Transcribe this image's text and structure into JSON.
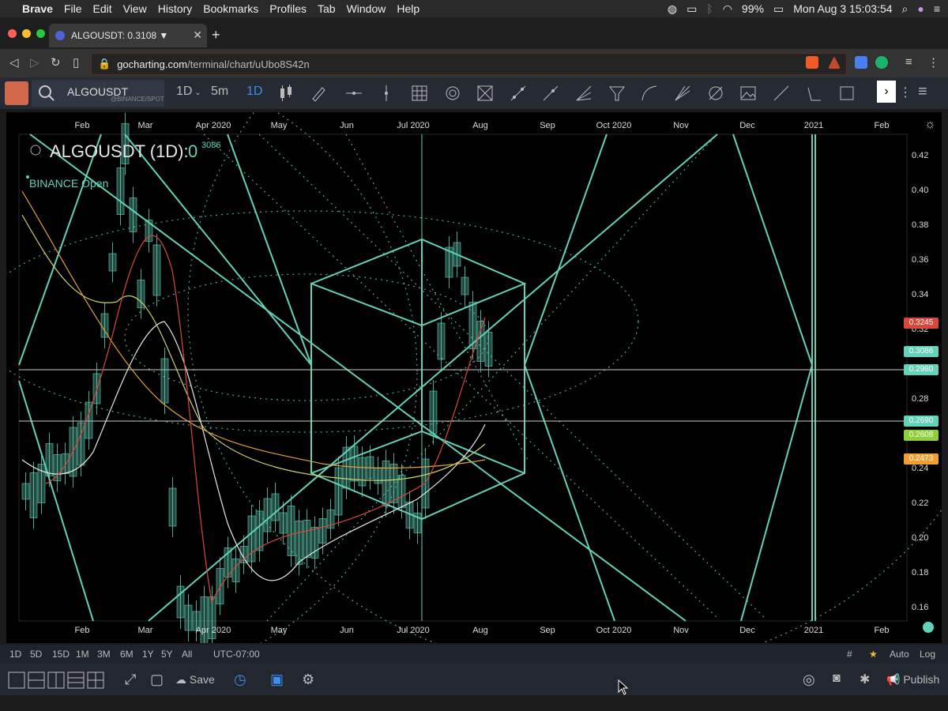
{
  "macos": {
    "app_name": "Brave",
    "menus": [
      "File",
      "Edit",
      "View",
      "History",
      "Bookmarks",
      "Profiles",
      "Tab",
      "Window",
      "Help"
    ],
    "battery": "99%",
    "datetime": "Mon Aug 3  15:03:54"
  },
  "browser": {
    "tab_title": "ALGOUSDT: 0.3108 ▼",
    "url_host": "gocharting.com",
    "url_path": "/terminal/chart/uUbo8S42n"
  },
  "toolbar": {
    "symbol": "ALGOUSDT",
    "exchange": "@BINANCE/SPOT",
    "interval_dropdown": "1D",
    "tf_5m": "5m",
    "tf_1d": "1D"
  },
  "chart": {
    "title": "ALGOUSDT (1D):",
    "title_value": "0",
    "title_value_sup": "3086",
    "exchange_status": "BINANCE Open",
    "x_labels": [
      "Feb",
      "Mar",
      "Apr 2020",
      "May",
      "Jun",
      "Jul 2020",
      "Aug",
      "Sep",
      "Oct 2020",
      "Nov",
      "Dec",
      "2021",
      "Feb"
    ],
    "y_labels": [
      "0.42",
      "0.40",
      "0.38",
      "0.36",
      "0.34",
      "0.32",
      "0.28",
      "0.26",
      "0.24",
      "0.22",
      "0.20",
      "0.18",
      "0.16"
    ],
    "price_tags": [
      {
        "value": "0.3245",
        "color": "#d9483b"
      },
      {
        "value": "0.3086",
        "color": "#63d2b9"
      },
      {
        "value": "0.2980",
        "color": "#63d2b9"
      },
      {
        "value": "0.2690",
        "color": "#63d2b9"
      },
      {
        "value": "0.2608",
        "color": "#8fcf3a"
      },
      {
        "value": "0.2473",
        "color": "#f0a030"
      }
    ],
    "accent": "#63d2b9"
  },
  "bottom": {
    "ranges": [
      "1D",
      "5D",
      "15D",
      "1M",
      "3M",
      "6M",
      "1Y",
      "5Y",
      "All"
    ],
    "timezone": "UTC-07:00",
    "auto": "Auto",
    "log": "Log",
    "save": "Save",
    "publish": "Publish"
  }
}
